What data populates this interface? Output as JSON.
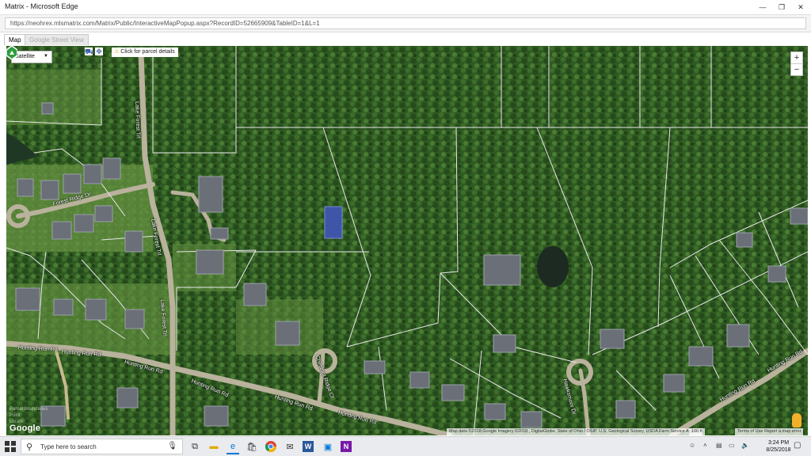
{
  "window": {
    "title": "Matrix - Microsoft Edge",
    "minimize_icon": "minimize-icon",
    "maximize_icon": "restore-icon",
    "close_icon": "close-icon"
  },
  "address_bar": {
    "url": "https://neohrex.mlsmatrix.com/Matrix/Public/InteractiveMapPopup.aspx?RecordID=52665909&TableID=1&L=1"
  },
  "tabs": [
    {
      "label": "Map",
      "active": true
    },
    {
      "label": "Google Street View",
      "active": false
    }
  ],
  "map": {
    "map_type_value": "Satellite",
    "parcel_hint": "Click for parcel details",
    "zoom_in": "+",
    "zoom_out": "−",
    "google_logo": "Google",
    "attribution": "Map data ©2018 Google Imagery ©2018 , DigitalGlobe, State of Ohio / OSIP, U.S. Geological Survey, USDA Farm Service Agency",
    "scale": "100 ft",
    "terms": "Terms of Use",
    "report": "Report a map error",
    "watermark": [
      "Parcel boundaries",
      "Point",
      "Lorain"
    ],
    "streets": [
      "Lake Forest Trl",
      "Forest Ridge Dr",
      "Lake Forest Trl",
      "Lake Forest Trl",
      "Hunting Run Rd",
      "Hunting Run Rd",
      "Hunting Run Rd",
      "Hunting Run Rd",
      "Hunting Run Rd",
      "Hunting Run Rd",
      "Chestnut Ridge Ct",
      "Hawksmoor Dr",
      "Hunting Run Rd",
      "Hunting Run Rd"
    ]
  },
  "taskbar": {
    "search_placeholder": "Type here to search",
    "time": "3:24 PM",
    "date": "8/25/2018",
    "apps": [
      "task-view-icon",
      "file-explorer-icon",
      "edge-icon",
      "store-icon",
      "chrome-icon",
      "mail-icon",
      "word-icon",
      "photos-icon",
      "onenote-icon"
    ]
  },
  "colors": {
    "map_base": "#2f5a22",
    "parcel_line": "#e8e8e8",
    "road": "#b9b29c",
    "accent": "#0078d7"
  }
}
